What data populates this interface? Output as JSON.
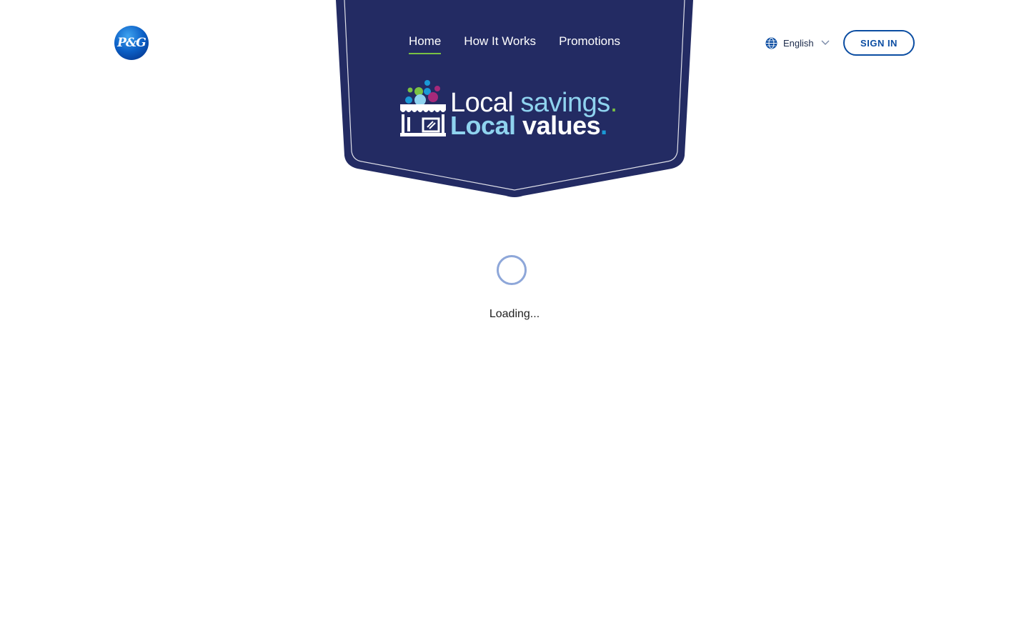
{
  "brand": {
    "logo_text": "P&G",
    "logo_icon": "pg-logo"
  },
  "nav": {
    "items": [
      {
        "label": "Home",
        "active": true
      },
      {
        "label": "How It Works",
        "active": false
      },
      {
        "label": "Promotions",
        "active": false
      }
    ]
  },
  "hero": {
    "line1_a": "Local",
    "line1_b": "savings",
    "line1_dot": ".",
    "line2_a": "Local",
    "line2_b": "values",
    "line2_dot": ".",
    "icon": "storefront-icon"
  },
  "language": {
    "icon": "globe-icon",
    "selected": "English",
    "chevron": "chevron-down-icon"
  },
  "auth": {
    "signin_label": "SIGN IN"
  },
  "status": {
    "loading_text": "Loading..."
  },
  "colors": {
    "shield_navy": "#232b63",
    "accent_green": "#7ac143",
    "accent_light_blue": "#8fd3ef",
    "button_blue": "#0b4da2",
    "spinner": "#8ea7d9"
  }
}
